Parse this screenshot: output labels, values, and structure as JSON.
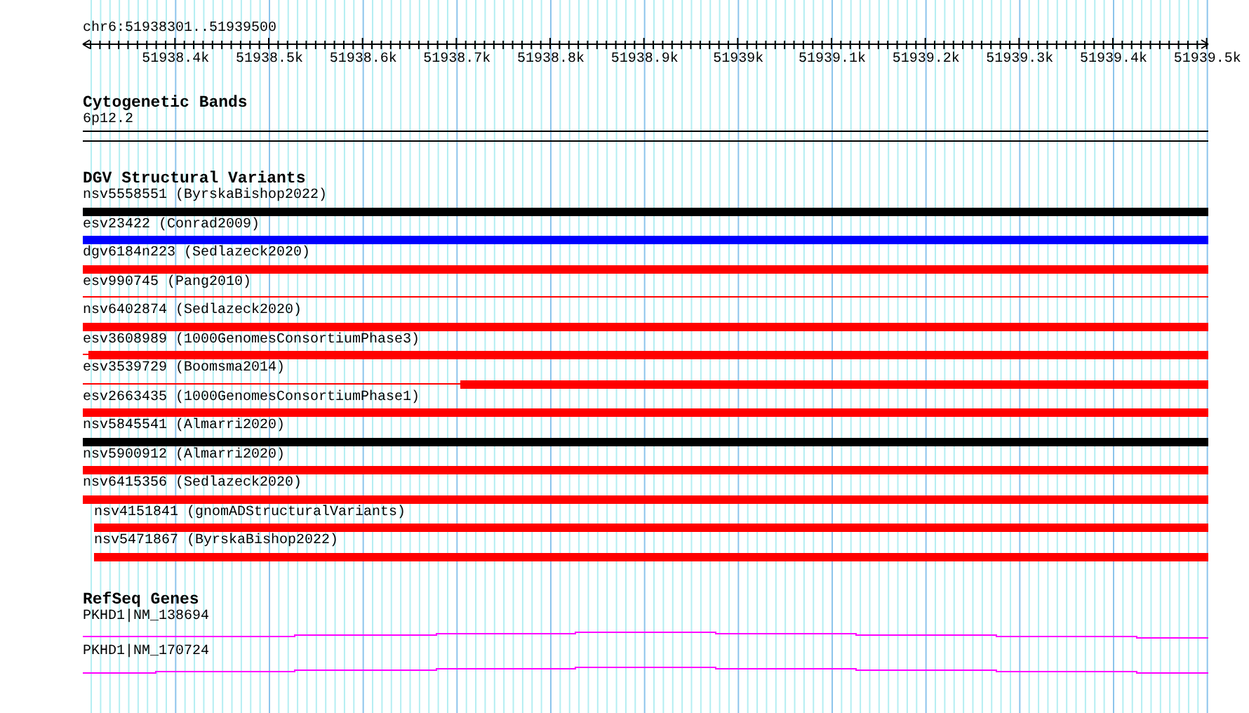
{
  "ruler": {
    "location": "chr6:51938301..51939500",
    "tick_labels": [
      "51938.4k",
      "51938.5k",
      "51938.6k",
      "51938.7k",
      "51938.8k",
      "51938.9k",
      "51939k",
      "51939.1k",
      "51939.2k",
      "51939.3k",
      "51939.4k",
      "51939.5k"
    ]
  },
  "cytogenetic_bands": {
    "title": "Cytogenetic Bands",
    "band": "6p12.2"
  },
  "dgv_structural_variants": {
    "title": "DGV Structural Variants",
    "features": [
      {
        "label": "nsv5558551 (ByrskaBishop2022)",
        "color": "#000000",
        "kind": "full"
      },
      {
        "label": "esv23422 (Conrad2009)",
        "color": "#0000ff",
        "kind": "full"
      },
      {
        "label": "dgv6184n223 (Sedlazeck2020)",
        "color": "#ff0000",
        "kind": "full"
      },
      {
        "label": "esv990745 (Pang2010)",
        "color": "#ff0000",
        "kind": "thin"
      },
      {
        "label": "nsv6402874 (Sedlazeck2020)",
        "color": "#ff0000",
        "kind": "full"
      },
      {
        "label": "esv3608989 (1000GenomesConsortiumPhase3)",
        "color": "#ff0000",
        "kind": "thin-lead"
      },
      {
        "label": "esv3539729 (Boomsma2014)",
        "color": "#ff0000",
        "kind": "right-part"
      },
      {
        "label": "esv2663435 (1000GenomesConsortiumPhase1)",
        "color": "#ff0000",
        "kind": "full"
      },
      {
        "label": "nsv5845541 (Almarri2020)",
        "color": "#000000",
        "kind": "full"
      },
      {
        "label": "nsv5900912 (Almarri2020)",
        "color": "#ff0000",
        "kind": "full"
      },
      {
        "label": "nsv6415356 (Sedlazeck2020)",
        "color": "#ff0000",
        "kind": "full"
      },
      {
        "label": "nsv4151841 (gnomADStructuralVariants)",
        "color": "#ff0000",
        "kind": "offset"
      },
      {
        "label": "nsv5471867 (ByrskaBishop2022)",
        "color": "#ff0000",
        "kind": "offset"
      }
    ]
  },
  "refseq_genes": {
    "title": "RefSeq Genes",
    "transcripts": [
      {
        "label": "PKHD1|NM_138694",
        "kind": "late-step"
      },
      {
        "label": "PKHD1|NM_170724",
        "kind": "early-step"
      }
    ]
  }
}
